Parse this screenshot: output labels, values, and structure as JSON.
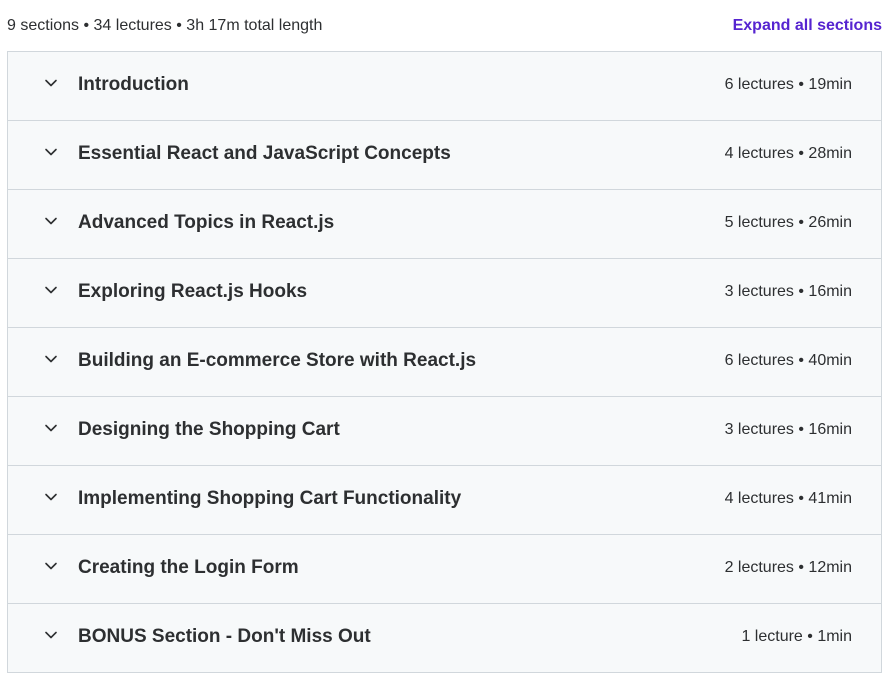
{
  "summary": {
    "text": "9 sections • 34 lectures • 3h 17m total length",
    "expand_label": "Expand all sections"
  },
  "sections": [
    {
      "title": "Introduction",
      "meta": "6 lectures • 19min"
    },
    {
      "title": "Essential React and JavaScript Concepts",
      "meta": "4 lectures • 28min"
    },
    {
      "title": "Advanced Topics in React.js",
      "meta": "5 lectures • 26min"
    },
    {
      "title": "Exploring React.js Hooks",
      "meta": "3 lectures • 16min"
    },
    {
      "title": "Building an E-commerce Store with React.js",
      "meta": "6 lectures • 40min"
    },
    {
      "title": "Designing the Shopping Cart",
      "meta": "3 lectures • 16min"
    },
    {
      "title": "Implementing Shopping Cart Functionality",
      "meta": "4 lectures • 41min"
    },
    {
      "title": "Creating the Login Form",
      "meta": "2 lectures • 12min"
    },
    {
      "title": "BONUS Section - Don't Miss Out",
      "meta": "1 lecture • 1min"
    }
  ],
  "icons": {
    "section_toggle": "chevron-down-icon"
  },
  "colors": {
    "accent": "#5624d0",
    "row_background": "#f7f9fa",
    "border": "#d1d7dc",
    "text": "#2d2f31"
  }
}
